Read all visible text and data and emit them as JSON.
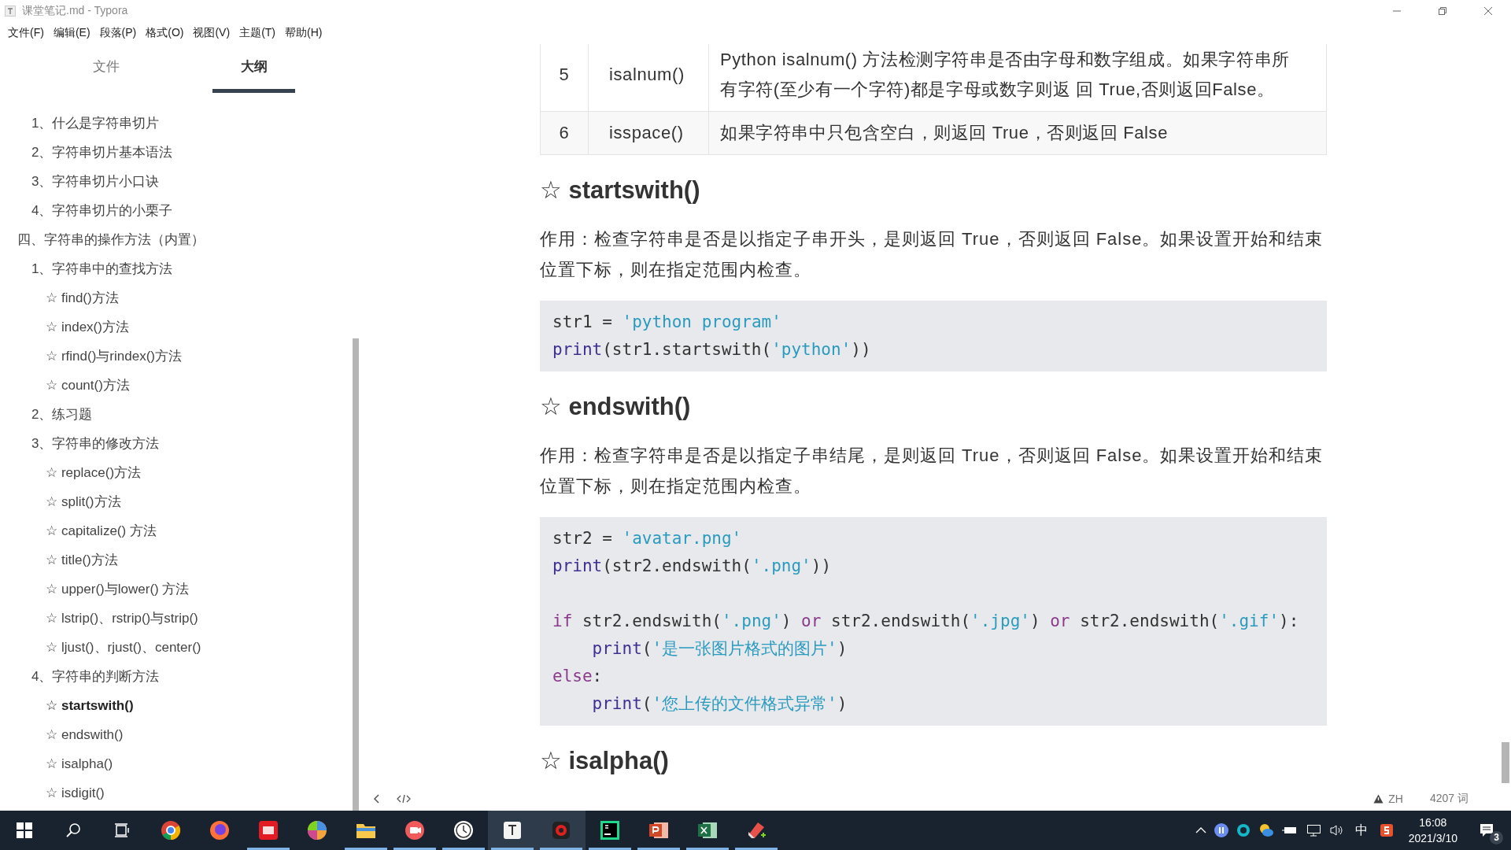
{
  "window": {
    "title": "课堂笔记.md - Typora"
  },
  "menu": [
    "文件(F)",
    "编辑(E)",
    "段落(P)",
    "格式(O)",
    "视图(V)",
    "主题(T)",
    "帮助(H)"
  ],
  "sidebar": {
    "tabs": [
      {
        "label": "文件",
        "selected": false
      },
      {
        "label": "大纲",
        "selected": true
      }
    ],
    "outline": [
      {
        "children": [
          {
            "label": "1、什么是字符串切片",
            "selected": false
          },
          {
            "label": "2、字符串切片基本语法",
            "selected": false
          },
          {
            "label": "3、字符串切片小口诀",
            "selected": false
          },
          {
            "label": "4、字符串切片的小栗子",
            "selected": false
          }
        ]
      },
      {
        "label": "四、字符串的操作方法（内置）",
        "selected": false,
        "children": [
          {
            "label": "1、字符串中的查找方法",
            "selected": false,
            "children": [
              {
                "label": "☆ find()方法",
                "selected": false
              },
              {
                "label": "☆ index()方法",
                "selected": false
              },
              {
                "label": "☆ rfind()与rindex()方法",
                "selected": false
              },
              {
                "label": "☆ count()方法",
                "selected": false
              }
            ]
          },
          {
            "label": "2、练习题",
            "selected": false
          },
          {
            "label": "3、字符串的修改方法",
            "selected": false,
            "children": [
              {
                "label": "☆ replace()方法",
                "selected": false
              },
              {
                "label": "☆ split()方法",
                "selected": false
              },
              {
                "label": "☆ capitalize() 方法",
                "selected": false
              },
              {
                "label": "☆ title()方法",
                "selected": false
              },
              {
                "label": "☆ upper()与lower() 方法",
                "selected": false
              },
              {
                "label": "☆ lstrip()、rstrip()与strip()",
                "selected": false
              },
              {
                "label": "☆ ljust()、rjust()、center()",
                "selected": false
              }
            ]
          },
          {
            "label": "4、字符串的判断方法",
            "selected": false,
            "children": [
              {
                "label": "☆ startswith()",
                "selected": true
              },
              {
                "label": "☆ endswith()",
                "selected": false
              },
              {
                "label": "☆ isalpha()",
                "selected": false
              },
              {
                "label": "☆ isdigit()",
                "selected": false
              }
            ]
          }
        ]
      }
    ]
  },
  "document": [
    {
      "kind": "table",
      "rows": [
        [
          "5",
          "isalnum()",
          " Python isalnum() 方法检测字符串是否由字母和数字组成。如果字符串所有字符(至少有一个字符)都是字母或数字则返 回 True,否则返回False。"
        ],
        [
          "6",
          "isspace()",
          " 如果字符串中只包含空白，则返回 True，否则返回 False"
        ]
      ]
    },
    {
      "kind": "heading",
      "text": "☆ startswith()"
    },
    {
      "kind": "paragraph",
      "text": "作用：检查字符串是否是以指定子串开头，是则返回 True，否则返回 False。如果设置开始和结束位置下标，则在指定范围内检查。"
    },
    {
      "kind": "code",
      "lines": [
        {
          "kind": "code",
          "tokens": [
            {
              "kind": "text",
              "text": "str1 = "
            },
            {
              "kind": "string",
              "text": "'python program'"
            }
          ]
        },
        {
          "kind": "code",
          "tokens": [
            {
              "kind": "builtin",
              "text": "print"
            },
            {
              "kind": "text",
              "text": "(str1.startswith("
            },
            {
              "kind": "string",
              "text": "'python'"
            },
            {
              "kind": "text",
              "text": "))"
            }
          ]
        }
      ]
    },
    {
      "kind": "heading",
      "text": "☆ endswith()"
    },
    {
      "kind": "paragraph",
      "text": "作用：检查字符串是否是以指定子串结尾，是则返回 True，否则返回 False。如果设置开始和结束位置下标，则在指定范围内检查。"
    },
    {
      "kind": "code",
      "lines": [
        {
          "kind": "code",
          "tokens": [
            {
              "kind": "text",
              "text": "str2 = "
            },
            {
              "kind": "string",
              "text": "'avatar.png'"
            }
          ]
        },
        {
          "kind": "code",
          "tokens": [
            {
              "kind": "builtin",
              "text": "print"
            },
            {
              "kind": "text",
              "text": "(str2.endswith("
            },
            {
              "kind": "string",
              "text": "'.png'"
            },
            {
              "kind": "text",
              "text": "))"
            }
          ]
        },
        {
          "kind": "blank"
        },
        {
          "kind": "code",
          "tokens": [
            {
              "kind": "keyword",
              "text": "if"
            },
            {
              "kind": "text",
              "text": " str2.endswith("
            },
            {
              "kind": "string",
              "text": "'.png'"
            },
            {
              "kind": "text",
              "text": ") "
            },
            {
              "kind": "keyword",
              "text": "or"
            },
            {
              "kind": "text",
              "text": " str2.endswith("
            },
            {
              "kind": "string",
              "text": "'.jpg'"
            },
            {
              "kind": "text",
              "text": ") "
            },
            {
              "kind": "keyword",
              "text": "or"
            },
            {
              "kind": "text",
              "text": " str2.endswith("
            },
            {
              "kind": "string",
              "text": "'.gif'"
            },
            {
              "kind": "text",
              "text": "):"
            }
          ]
        },
        {
          "kind": "code",
          "indent": true,
          "tokens": [
            {
              "kind": "builtin",
              "text": "print"
            },
            {
              "kind": "text",
              "text": "("
            },
            {
              "kind": "string",
              "text": "'是一张图片格式的图片'"
            },
            {
              "kind": "text",
              "text": ")"
            }
          ]
        },
        {
          "kind": "code",
          "tokens": [
            {
              "kind": "keyword",
              "text": "else"
            },
            {
              "kind": "text",
              "text": ":"
            }
          ]
        },
        {
          "kind": "code",
          "indent": true,
          "tokens": [
            {
              "kind": "builtin",
              "text": "print"
            },
            {
              "kind": "text",
              "text": "("
            },
            {
              "kind": "string",
              "text": "'您上传的文件格式异常'"
            },
            {
              "kind": "text",
              "text": ")"
            }
          ]
        }
      ]
    },
    {
      "kind": "heading",
      "text": "☆ isalpha()"
    }
  ],
  "status_bar": {
    "language": "ZH",
    "word_count": "4207 词"
  },
  "taskbar": {
    "apps": [
      {
        "kind": "chrome",
        "running": false,
        "selected": false
      },
      {
        "kind": "firefox",
        "running": false,
        "selected": false
      },
      {
        "kind": "youdao",
        "running": true,
        "selected": false
      },
      {
        "kind": "pinwheel",
        "running": false,
        "selected": false
      },
      {
        "kind": "folder",
        "running": true,
        "selected": false
      },
      {
        "kind": "recorder",
        "running": true,
        "selected": false
      },
      {
        "kind": "clock",
        "running": true,
        "selected": false
      },
      {
        "kind": "typora",
        "running": true,
        "selected": true
      },
      {
        "kind": "record",
        "running": true,
        "selected": true
      },
      {
        "kind": "pycharm",
        "running": true,
        "selected": false
      },
      {
        "kind": "powerpoint",
        "running": true,
        "selected": false
      },
      {
        "kind": "excel",
        "running": true,
        "selected": false
      },
      {
        "kind": "eraser",
        "running": true,
        "selected": false
      }
    ],
    "ime": "中",
    "time": "16:08",
    "date": "2021/3/10",
    "notifications": "3"
  }
}
